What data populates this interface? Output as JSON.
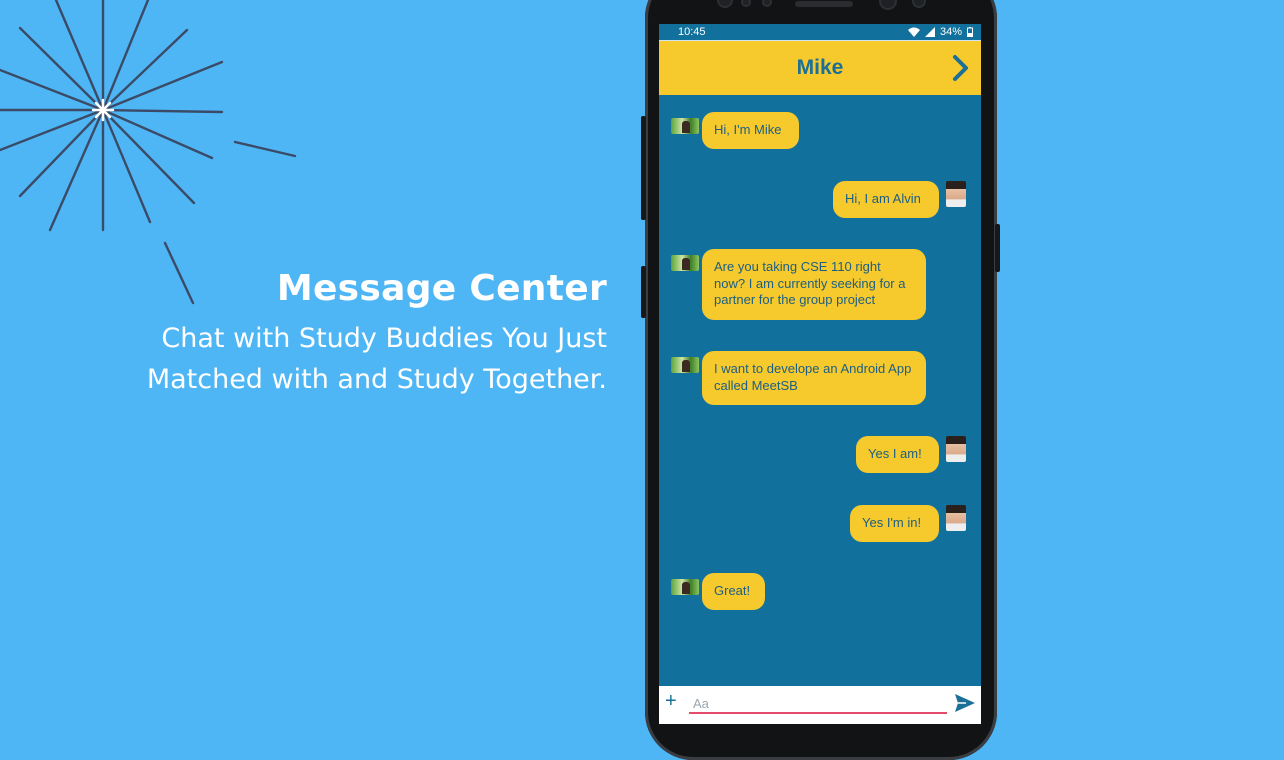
{
  "promo": {
    "title": "Message Center",
    "subtitle_line1": "Chat with Study Buddies You Just",
    "subtitle_line2": "Matched with and Study Together."
  },
  "status_bar": {
    "time": "10:45",
    "battery": "34%"
  },
  "chat": {
    "contact_name": "Mike",
    "messages": [
      {
        "direction": "incoming",
        "text": "Hi, I'm Mike"
      },
      {
        "direction": "outgoing",
        "text": "Hi, I am Alvin"
      },
      {
        "direction": "incoming",
        "text": "Are you taking CSE 110 right now? I am currently seeking for a partner for the group project"
      },
      {
        "direction": "incoming",
        "text": "I want to develope an Android App called MeetSB"
      },
      {
        "direction": "outgoing",
        "text": "Yes I am!"
      },
      {
        "direction": "outgoing",
        "text": "Yes I'm in!"
      },
      {
        "direction": "incoming",
        "text": "Great!"
      }
    ],
    "input_placeholder": "Aa",
    "add_label": "+"
  },
  "colors": {
    "background": "#4fb6f5",
    "chat_background": "#12719c",
    "accent_yellow": "#f6c92c",
    "header_text": "#1c6f96",
    "input_underline": "#e54b6b"
  },
  "icons": {
    "next": "chevron-right-icon",
    "send": "send-icon",
    "wifi": "wifi-icon",
    "signal": "signal-icon",
    "battery": "battery-icon"
  }
}
